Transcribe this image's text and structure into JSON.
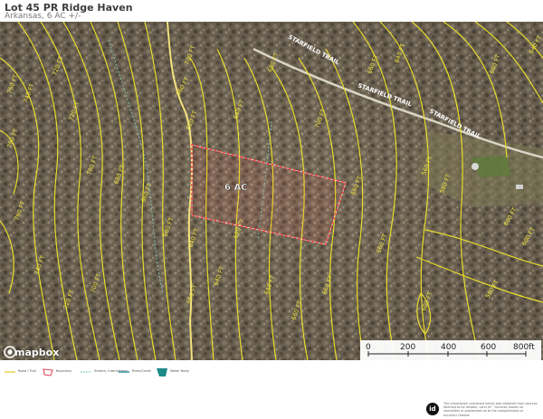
{
  "header": {
    "title": "Lot 45 PR Ridge Haven",
    "subtitle": "Arkansas, 6 AC +/-"
  },
  "map": {
    "parcel_label": "6 AC",
    "road_labels": [
      "STARFIELD TRAIL",
      "STARFIELD TRAIL",
      "STARFIELD TRAIL"
    ],
    "contour_labels": [
      "700 FT",
      "680 FT",
      "660 FT",
      "640 FT",
      "620 FT",
      "720 FT",
      "740 FT",
      "760 FT",
      "780 FT",
      "560 FT",
      "580 FT",
      "600 FT"
    ],
    "colors": {
      "contour": "#e8dc2c",
      "boundary": "#ff3b3b",
      "road": "#f3e27a",
      "stream": "#7fc3b6"
    }
  },
  "attribution": {
    "logo_text": "mapbox",
    "logo_icon": "mapbox-circle-icon"
  },
  "scale": {
    "ticks": [
      "0",
      "200",
      "400",
      "600",
      "800ft"
    ]
  },
  "legend": {
    "items": [
      {
        "label": "Road / Trail",
        "icon": "road-line-icon"
      },
      {
        "label": "Boundary",
        "icon": "boundary-polygon-icon"
      },
      {
        "label": "Stream, Intermittent",
        "icon": "stream-dashed-icon"
      },
      {
        "label": "River/Creek",
        "icon": "river-line-icon"
      },
      {
        "label": "Water Body",
        "icon": "water-body-icon"
      }
    ]
  },
  "footer": {
    "badge": "id",
    "disclaimer": "The information contained herein was obtained from sources deemed to be reliable. Land id™ Services makes no warranties or guarantees as to the completeness or accuracy thereof."
  }
}
